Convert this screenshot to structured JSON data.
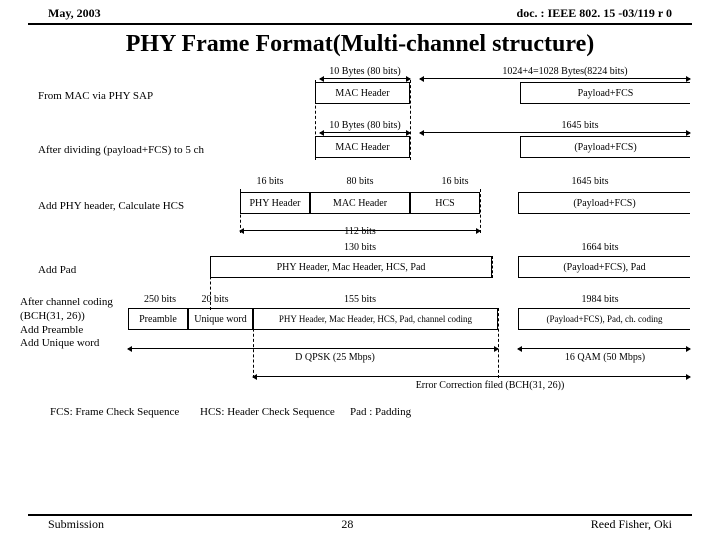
{
  "header": {
    "date": "May, 2003",
    "doc": "doc. : IEEE 802. 15 -03/119 r 0"
  },
  "title": "PHY Frame Format(Multi-channel structure)",
  "row1": {
    "label": "From MAC via PHY SAP",
    "seg_a": "10 Bytes (80 bits)",
    "seg_b": "1024+4=1028 Bytes(8224 bits)",
    "box_a": "MAC Header",
    "box_b": "Payload+FCS"
  },
  "row2": {
    "label": "After dividing (payload+FCS) to 5 ch",
    "seg_a": "10 Bytes (80 bits)",
    "seg_b": "1645 bits",
    "box_a": "MAC Header",
    "box_b": "(Payload+FCS)"
  },
  "row3": {
    "label": "Add PHY header, Calculate HCS",
    "seg_a": "16 bits",
    "seg_b": "80 bits",
    "seg_c": "16 bits",
    "seg_d": "1645 bits",
    "box_a": "PHY Header",
    "box_b": "MAC Header",
    "box_c": "HCS",
    "box_d": "(Payload+FCS)"
  },
  "row4": {
    "label": "Add Pad",
    "seg_a": "130 bits",
    "seg_b": "1664 bits",
    "box_a": "PHY Header, Mac Header, HCS, Pad",
    "box_b": "(Payload+FCS), Pad",
    "above": "112 bits"
  },
  "row5": {
    "label": "After channel coding\n (BCH(31, 26))\nAdd Preamble\nAdd Unique word",
    "seg_a": "250 bits",
    "seg_b": "20 bits",
    "seg_c": "155 bits",
    "seg_d": "1984 bits",
    "box_a": "Preamble",
    "box_b": "Unique word",
    "box_c": "PHY Header, Mac Header, HCS, Pad, channel coding",
    "box_d": "(Payload+FCS), Pad, ch. coding",
    "mod_a": "    D QPSK (25 Mbps)",
    "mod_b": "16 QAM (50 Mbps)"
  },
  "ecc": "Error Correction filed (BCH(31, 26))",
  "glossary": {
    "fcs": "FCS: Frame Check Sequence",
    "hcs": "HCS: Header Check Sequence",
    "pad": "Pad : Padding"
  },
  "footer": {
    "left": "Submission",
    "page": "28",
    "right": "Reed Fisher, Oki"
  }
}
